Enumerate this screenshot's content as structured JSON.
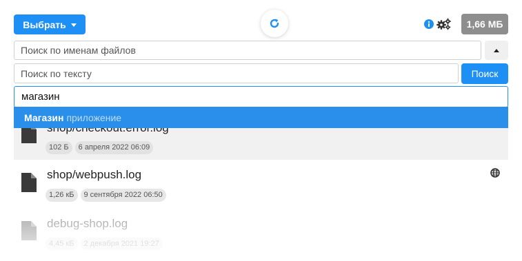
{
  "toolbar": {
    "select_label": "Выбрать",
    "storage_used": "1,66 МБ"
  },
  "search": {
    "filename_placeholder": "Поиск по именам файлов",
    "text_placeholder": "Поиск по тексту",
    "search_button": "Поиск",
    "tag_value": "магазин"
  },
  "suggestion": {
    "bold": "Магазин",
    "light": "приложение"
  },
  "files": [
    {
      "dir": "shop/",
      "name": "checkout.error.log",
      "size": "102 Б",
      "date": "6 апреля 2022 06:09"
    },
    {
      "dir": "shop/",
      "name": "webpush.log",
      "size": "1,26 кБ",
      "date": "9 сентября 2022 06:50",
      "public_icon": "globe-icon"
    },
    {
      "dir": "",
      "name": "debug-shop.log",
      "size": "4,45 кБ",
      "date": "2 декабря 2021 19:27"
    }
  ],
  "colors": {
    "accent": "#1e90f5",
    "suggestion_bg": "#2a8fea",
    "badge_bg": "#8e8e8e"
  }
}
